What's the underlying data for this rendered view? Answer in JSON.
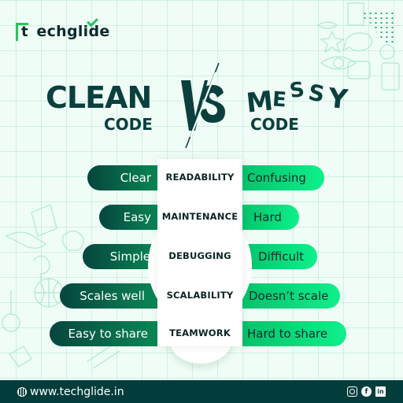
{
  "brand": {
    "logo_text": "techglide",
    "logo_first_letter": "t",
    "logo_rest": "echglide",
    "accent_color": "#22c55e",
    "dark_color": "#0b3f3d"
  },
  "heading": {
    "left_title": "CLEAN",
    "left_subtitle": "CODE",
    "vs": "VS",
    "right_title_letters": [
      "M",
      "E",
      "S",
      "S",
      "Y"
    ],
    "right_subtitle": "CODE"
  },
  "comparison": {
    "rows": [
      {
        "clean": "Clear",
        "aspect": "READABILITY",
        "messy": "Confusing"
      },
      {
        "clean": "Easy",
        "aspect": "MAINTENANCE",
        "messy": "Hard"
      },
      {
        "clean": "Simple",
        "aspect": "DEBUGGING",
        "messy": "Difficult"
      },
      {
        "clean": "Scales well",
        "aspect": "SCALABILITY",
        "messy": "Doesn’t scale"
      },
      {
        "clean": "Easy to share",
        "aspect": "TEAMWORK",
        "messy": "Hard to share"
      }
    ]
  },
  "footer": {
    "website": "www.techglide.in",
    "globe_icon": "globe-icon",
    "socials": [
      {
        "name": "instagram",
        "icon": "instagram-icon"
      },
      {
        "name": "facebook",
        "icon": "facebook-icon",
        "glyph": "f"
      },
      {
        "name": "linkedin",
        "icon": "linkedin-icon",
        "glyph": "in"
      }
    ]
  }
}
